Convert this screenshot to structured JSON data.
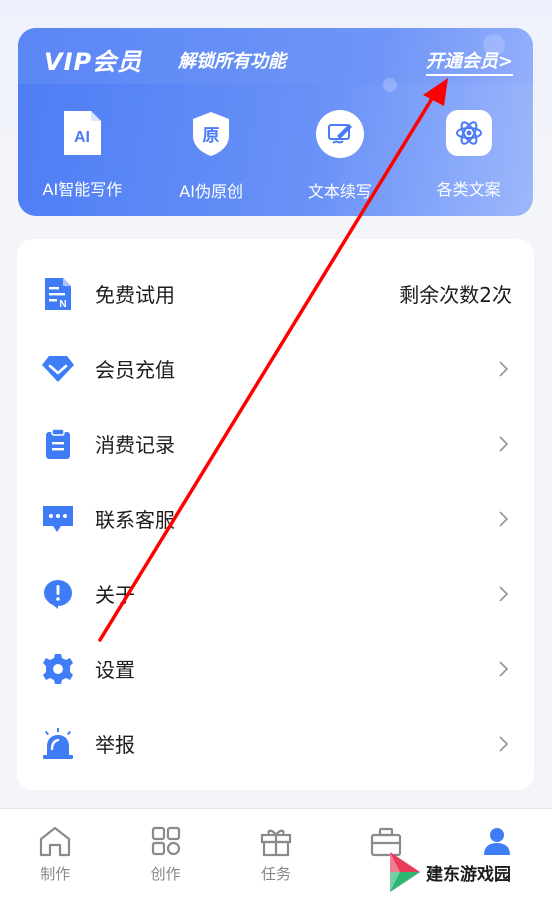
{
  "vip": {
    "title": "VIP会员",
    "subtitle": "解锁所有功能",
    "open_label": "开通会员>",
    "features": [
      {
        "label": "AI智能写作",
        "icon": "ai-document-icon"
      },
      {
        "label": "AI伪原创",
        "icon": "original-shield-icon"
      },
      {
        "label": "文本续写",
        "icon": "pen-write-icon"
      },
      {
        "label": "各类文案",
        "icon": "atom-icon"
      }
    ]
  },
  "menu": {
    "items": [
      {
        "label": "免费试用",
        "right_text": "剩余次数2次",
        "icon": "document-n-icon"
      },
      {
        "label": "会员充值",
        "icon": "diamond-icon"
      },
      {
        "label": "消费记录",
        "icon": "clipboard-icon"
      },
      {
        "label": "联系客服",
        "icon": "chat-bubble-icon"
      },
      {
        "label": "关于",
        "icon": "info-bubble-icon"
      },
      {
        "label": "设置",
        "icon": "gear-icon"
      },
      {
        "label": "举报",
        "icon": "alarm-light-icon"
      }
    ]
  },
  "nav": {
    "items": [
      {
        "label": "制作",
        "icon": "home-icon"
      },
      {
        "label": "创作",
        "icon": "grid-icon"
      },
      {
        "label": "任务",
        "icon": "gift-icon"
      },
      {
        "label": "",
        "icon": "briefcase-icon"
      },
      {
        "label": "",
        "icon": "user-icon"
      }
    ]
  },
  "watermark": {
    "text": "建东游戏园"
  },
  "colors": {
    "accent": "#3f7df6",
    "arrow": "#ff0000"
  }
}
